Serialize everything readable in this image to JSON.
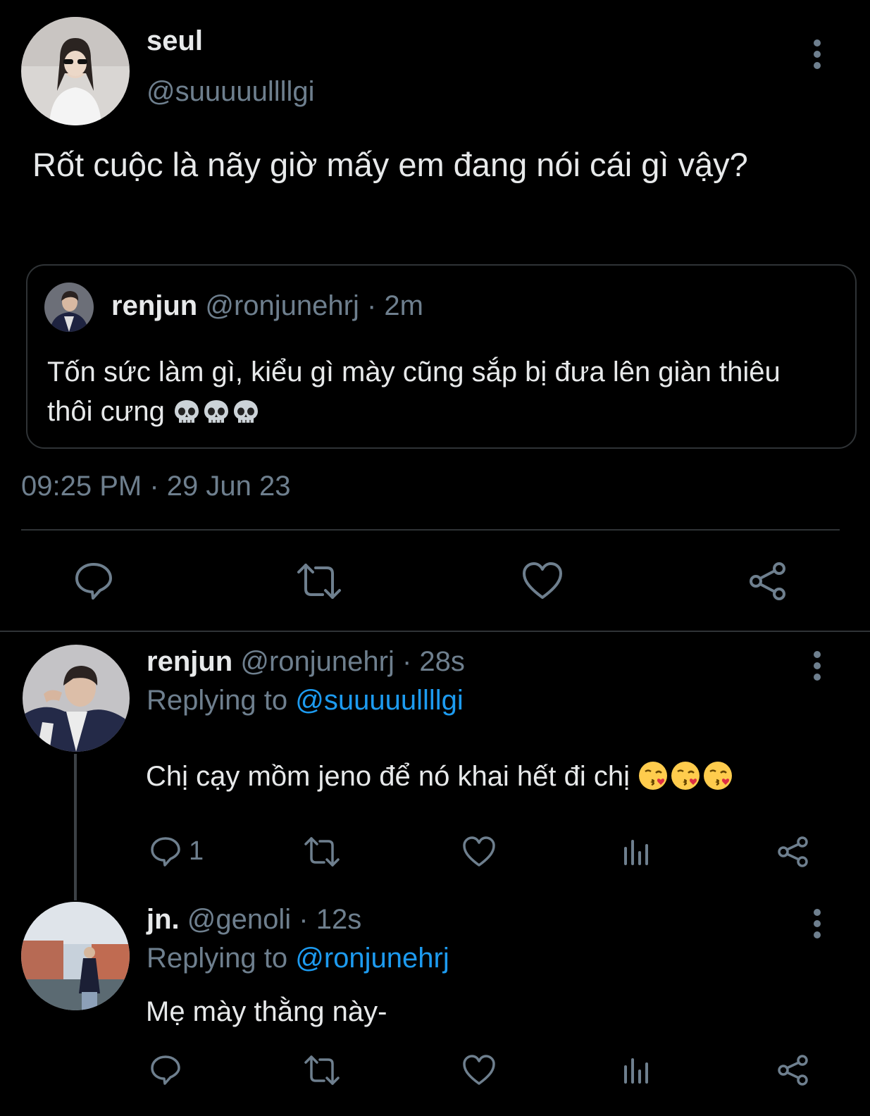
{
  "main_tweet": {
    "name": "seul",
    "handle": "@suuuuullllgi",
    "text": "Rốt cuộc là nãy giờ mấy em đang nói cái gì vậy?",
    "timestamp": "09:25 PM · 29 Jun 23",
    "quote": {
      "name": "renjun",
      "handle": "@ronjunehrj",
      "time": "· 2m",
      "text": "Tốn sức làm gì, kiểu gì mày cũng sắp bị đưa lên giàn thiêu thôi cưng",
      "emoji": "skull"
    }
  },
  "replies": [
    {
      "name": "renjun",
      "handle": "@ronjunehrj",
      "time": "· 28s",
      "replying_prefix": "Replying to",
      "replying_to": "@suuuuullllgi",
      "text": "Chị cạy mồm jeno để nó khai hết đi chị",
      "emoji": "kissing-heart",
      "reply_count": "1"
    },
    {
      "name": "jn.",
      "handle": "@genoli",
      "time": "· 12s",
      "replying_prefix": "Replying to",
      "replying_to": "@ronjunehrj",
      "text": "Mẹ mày thằng này-",
      "reply_count": ""
    }
  ],
  "colors": {
    "background": "#000000",
    "muted": "#6e7f8e",
    "accent": "#1d9bf0",
    "text": "#e7e9ea"
  }
}
